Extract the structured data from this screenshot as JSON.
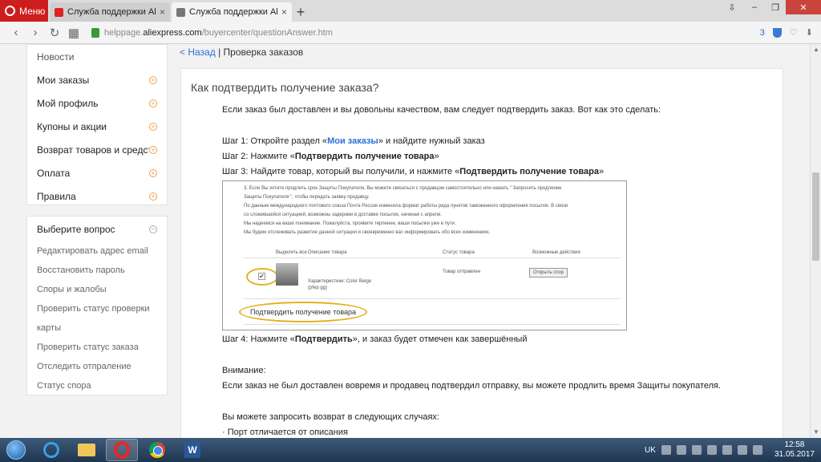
{
  "browser": {
    "menu_label": "Меню",
    "tabs": [
      {
        "title": "Служба поддержки AliExp"
      },
      {
        "title": "Служба поддержки AliExp"
      }
    ],
    "new_tab": "+",
    "url_prefix": "helppage.",
    "url_host": "aliexpress.com",
    "url_path": "/buyercenter/questionAnswer.htm",
    "shield_count": "3"
  },
  "sidebar": {
    "box1": [
      {
        "label": "Новости",
        "expand": false
      },
      {
        "label": "Мои заказы",
        "expand": true
      },
      {
        "label": "Мой профиль",
        "expand": true
      },
      {
        "label": "Купоны и акции",
        "expand": true
      },
      {
        "label": "Возврат товаров и средств",
        "expand": true
      },
      {
        "label": "Оплата",
        "expand": true
      },
      {
        "label": "Правила",
        "expand": true
      }
    ],
    "box2_title": "Выберите вопрос",
    "box2": [
      "Редактировать адрес email",
      "Восстановить пароль",
      "Споры и жалобы",
      "Проверить статус проверки",
      "карты",
      "Проверить статус заказа",
      "Отследить отпраление",
      "Статус спора"
    ]
  },
  "breadcrumb": {
    "back": "< Назад",
    "sep": "|",
    "current": "Проверка заказов"
  },
  "article": {
    "title": "Как подтвердить получение заказа?",
    "intro": "Если заказ был доставлен и вы довольны качеством, вам следует подтвердить заказ. Вот как это сделать:",
    "step1_a": "Шаг 1: Откройте раздел «",
    "step1_link": "Мои заказы",
    "step1_b": "» и найдите нужный заказ",
    "step2_a": "Шаг 2: Нажмите «",
    "step2_bold": "Подтвердить получение товара",
    "step2_b": "»",
    "step3_a": "Шаг 3: Найдите товар, который вы получили, и нажмите «",
    "step3_bold": "Подтвердить получение товара",
    "step3_b": "»",
    "step4_a": "Шаг 4: Нажмите «",
    "step4_bold": "Подтвердить",
    "step4_b": "», и заказ будет отмечен как завершённый",
    "attention_title": "Внимание:",
    "attention_text": "Если заказ не был доставлен вовремя и продавец подтвердил отправку, вы можете продлить время Защиты покупателя.",
    "refund_title": "Вы можете запросить возврат в следующих случаях:",
    "refund_item": "· Порт отличается от описания"
  },
  "screenshot": {
    "lines": [
      "3. Если Вы хотите продлить срок Защиты Покупателя, Вы можете связаться с продавцом самостоятельно или нажать \" Запросить продление",
      "Защиты Покупателя \", чтобы передать заявку продавцу.",
      "По данным международного почтового союза Почта России изменила формат работы ряда пунктов таможенного оформления посылок. В связи",
      "со сложившейся ситуацией, возможны задержки в доставке посылок, начиная с апреля.",
      "Мы надеемся на ваше понимание. Пожалуйста, проявите терпение, ваши посылки уже в пути.",
      "Мы будем отслеживать развитие данной ситуации и своевременно вас информировать обо всех изменениях."
    ],
    "col_select": "Выделить все",
    "col_desc": "Описание товара",
    "col_status": "Статус товара",
    "col_actions": "Возможные действия",
    "item_desc": "Характеристики: Color Beige",
    "item_code": "(pfep gg)",
    "item_status": "Товар отправлен",
    "open_dispute": "Открыть спор",
    "confirm_btn": "Подтвердить получение товара"
  },
  "taskbar": {
    "lang": "UK",
    "time": "12:58",
    "date": "31.05.2017"
  }
}
